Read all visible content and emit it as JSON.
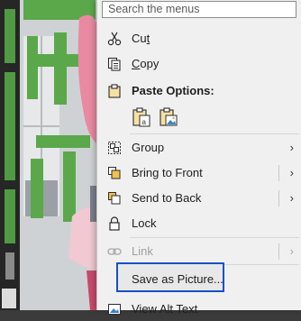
{
  "colors": {
    "menu_bg": "#f0f0f0",
    "highlight_border": "#1651c8",
    "title_green": "#5aa84a",
    "hair_pink": "#e98aa2"
  },
  "menu": {
    "search_placeholder": "Search the menus",
    "items": [
      {
        "label": "Cut",
        "icon": "scissors-icon",
        "underline": "t"
      },
      {
        "label": "Copy",
        "icon": "copy-icon",
        "underline": "C"
      },
      {
        "label": "Paste Options:",
        "icon": "clipboard-icon"
      },
      {
        "label": "Group",
        "icon": "group-icon",
        "submenu": true
      },
      {
        "label": "Bring to Front",
        "icon": "bring-to-front-icon",
        "submenu": true
      },
      {
        "label": "Send to Back",
        "icon": "send-to-back-icon",
        "submenu": true
      },
      {
        "label": "Lock",
        "icon": "lock-icon"
      },
      {
        "label": "Link",
        "icon": "link-icon",
        "submenu": true,
        "disabled": true
      },
      {
        "label": "Save as Picture...",
        "icon": "save-picture-icon",
        "highlighted": true
      },
      {
        "label": "View Alt Text",
        "icon": "alt-text-icon"
      }
    ],
    "paste_options": [
      "paste-keep-text-icon",
      "paste-picture-icon"
    ]
  }
}
